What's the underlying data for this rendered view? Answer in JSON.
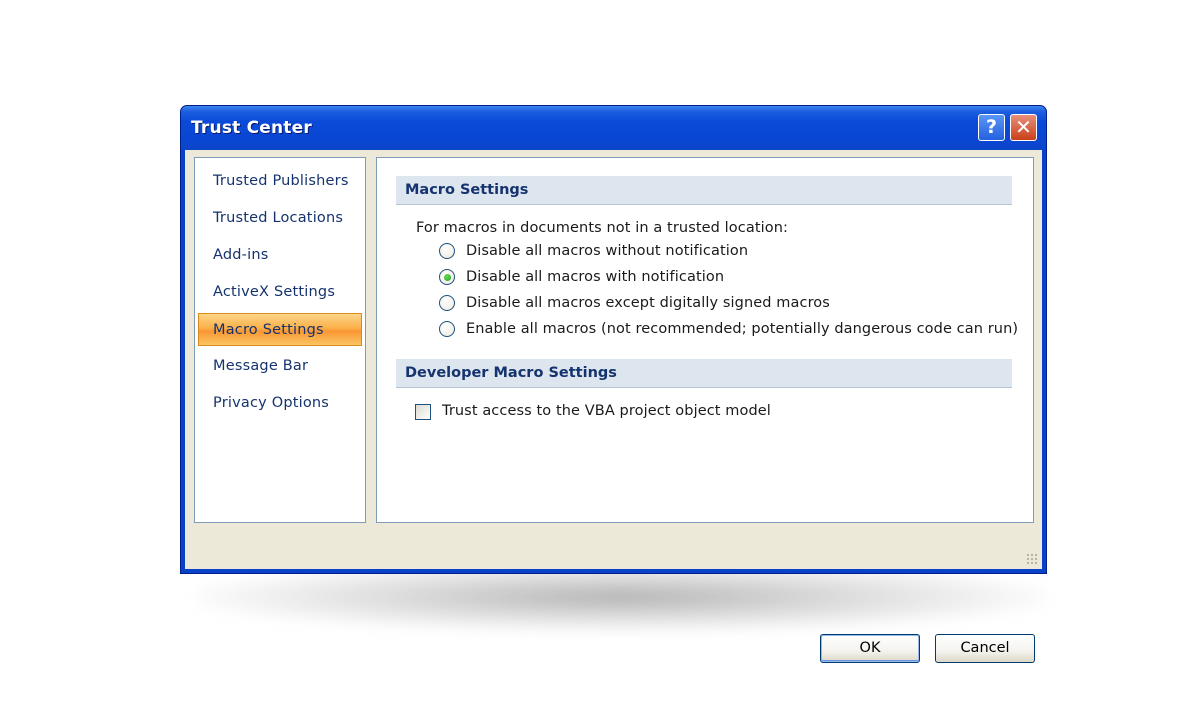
{
  "window": {
    "title": "Trust Center",
    "help_glyph": "?",
    "close_glyph": "✕",
    "colors": {
      "titlebar": "#0a46d4",
      "client": "#ece9d8",
      "selected_nav": "#f99733"
    }
  },
  "sidebar": {
    "items": [
      {
        "label": "Trusted Publishers",
        "selected": false
      },
      {
        "label": "Trusted Locations",
        "selected": false
      },
      {
        "label": "Add-ins",
        "selected": false
      },
      {
        "label": "ActiveX Settings",
        "selected": false
      },
      {
        "label": "Macro Settings",
        "selected": true
      },
      {
        "label": "Message Bar",
        "selected": false
      },
      {
        "label": "Privacy Options",
        "selected": false
      }
    ]
  },
  "main": {
    "macro_section": {
      "header": "Macro Settings",
      "intro": "For macros in documents not in a trusted location:",
      "options": [
        {
          "label": "Disable all macros without notification",
          "checked": false
        },
        {
          "label": "Disable all macros with notification",
          "checked": true
        },
        {
          "label": "Disable all macros except digitally signed macros",
          "checked": false
        },
        {
          "label": "Enable all macros (not recommended; potentially dangerous code can run)",
          "checked": false
        }
      ]
    },
    "developer_section": {
      "header": "Developer Macro Settings",
      "checkbox_label": "Trust access to the VBA project object model",
      "checkbox_checked": false
    }
  },
  "footer": {
    "ok_label": "OK",
    "cancel_label": "Cancel"
  }
}
